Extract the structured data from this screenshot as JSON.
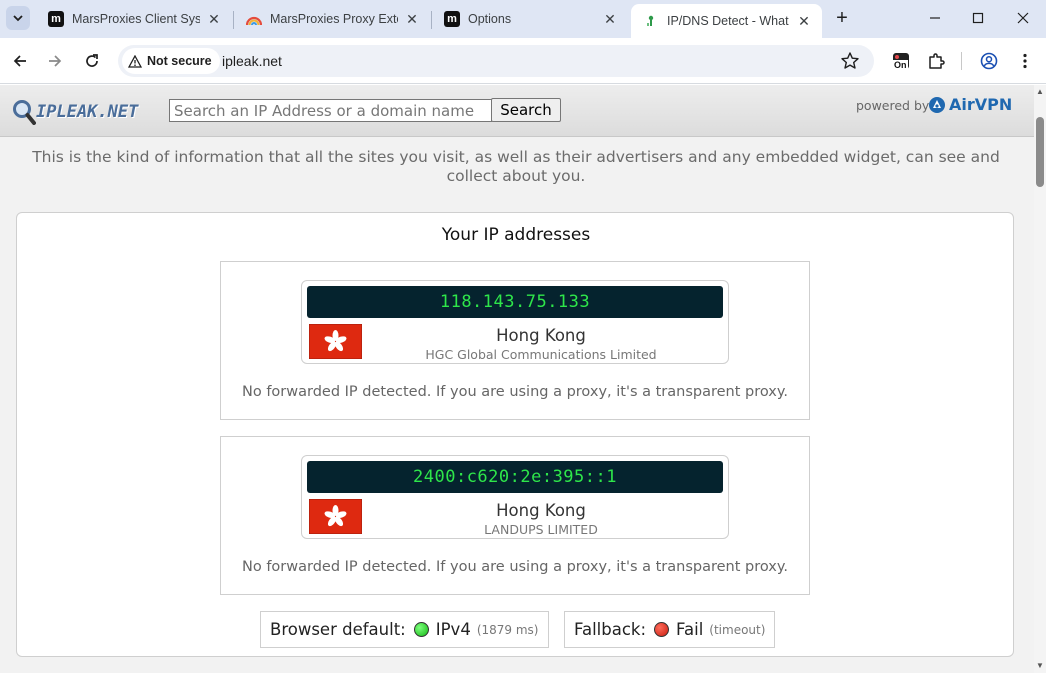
{
  "browser": {
    "tabs": [
      {
        "title": "MarsProxies Client Syste",
        "favicon": "marsproxies-icon",
        "active": false
      },
      {
        "title": "MarsProxies Proxy Exten",
        "favicon": "rainbow-icon",
        "active": false
      },
      {
        "title": "Options",
        "favicon": "marsproxies-icon",
        "active": false
      },
      {
        "title": "IP/DNS Detect - What is",
        "favicon": "ipleak-icon",
        "active": true
      }
    ],
    "security_label": "Not secure",
    "url": "ipleak.net",
    "extension_badge": "On"
  },
  "header": {
    "logo_text": "IPLEAK.NET",
    "search_placeholder": "Search an IP Address or a domain name",
    "search_button": "Search",
    "powered_by": "powered by",
    "sponsor": "AirVPN"
  },
  "intro_text": "This is the kind of information that all the sites you visit, as well as their advertisers and any embedded widget, can see and collect about you.",
  "ip_section": {
    "title": "Your IP addresses",
    "addresses": [
      {
        "ip": "118.143.75.133",
        "country": "Hong Kong",
        "isp": "HGC Global Communications Limited",
        "forwarded_note": "No forwarded IP detected. If you are using a proxy, it's a transparent proxy."
      },
      {
        "ip": "2400:c620:2e:395::1",
        "country": "Hong Kong",
        "isp": "LANDUPS LIMITED",
        "forwarded_note": "No forwarded IP detected. If you are using a proxy, it's a transparent proxy."
      }
    ],
    "browser_default": {
      "label": "Browser default:",
      "value": "IPv4",
      "detail": "(1879 ms)",
      "status_color": "#14b814"
    },
    "fallback": {
      "label": "Fallback:",
      "value": "Fail",
      "detail": "(timeout)",
      "status_color": "#c81d10"
    }
  }
}
